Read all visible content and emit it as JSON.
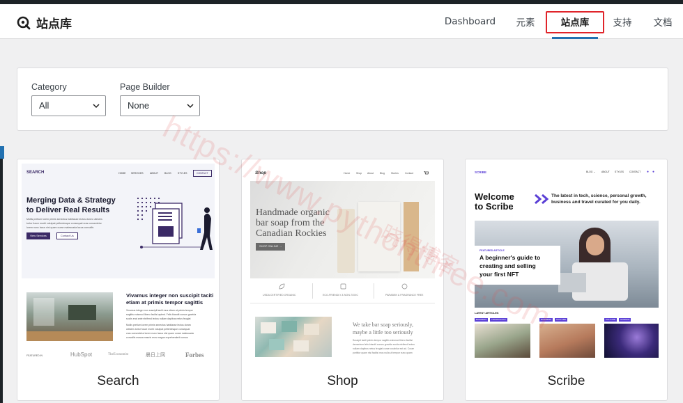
{
  "app": {
    "title": "站点库"
  },
  "nav": {
    "items": [
      {
        "label": "Dashboard",
        "active": false
      },
      {
        "label": "元素",
        "active": false
      },
      {
        "label": "站点库",
        "active": true
      },
      {
        "label": "支持",
        "active": false
      },
      {
        "label": "文档",
        "active": false
      }
    ]
  },
  "filters": {
    "category": {
      "label": "Category",
      "value": "All"
    },
    "page_builder": {
      "label": "Page Builder",
      "value": "None"
    }
  },
  "colors": {
    "accent": "#2271b1",
    "highlight": "#e0242a",
    "search_purple": "#3b2a66",
    "scribe_purple": "#5b40d6"
  },
  "watermark": {
    "url": "https://www.pythonthree.com",
    "cn": "晓得博客"
  },
  "templates": [
    {
      "title": "Search",
      "preview": {
        "brand": "SEARCH",
        "menu": [
          "HOME",
          "SERVICES",
          "ABOUT",
          "BLOG",
          "STYLES"
        ],
        "contact": "CONTACT",
        "headline_1": "Merging Data & Strategy",
        "headline_2": "to Deliver Real Results",
        "body_1": "Mollis pretium lorem primis senectus habitasse lectus donec ultricies",
        "body_2": "tortor fusce morbi volutpat pellentesque consequat cras consectetur",
        "body_3": "lorem nunc lacus nisi quam curae malesuada lacus convallis",
        "btn_primary": "View Services",
        "btn_secondary": "Contact Us",
        "section_1": "Vivamus integer non suscipit taciti",
        "section_2": "etiam at primis tempor sagittis",
        "section_body_1": "Vivamus integer non suscipit taciti mus etiam at primis tempor",
        "section_body_2": "sagittis euismod libero facilisi aptent. Felis blandit cursus gravida",
        "section_body_3": "sociis erat ante eleifend lectus nullam dapibus netus feugiat",
        "section_body_4": "Mollis pretium lorem primis senectus habitasse lectus donec",
        "section_body_5": "ultricies tortor fusce morbi volutpat pellentesque consequat",
        "section_body_6": "cras consectetur lorem nunc lacus nisi quam curae malesuada",
        "section_body_7": "convallis massa mauris eros magna reprehenderit cursus",
        "featured_label": "FEATURED IN",
        "logos": [
          "HubSpot",
          "TheEconomist",
          "晨日上网",
          "Forbes"
        ]
      }
    },
    {
      "title": "Shop",
      "preview": {
        "brand": "Shop",
        "menu": [
          "Home",
          "Shop",
          "About",
          "Blog",
          "Stories",
          "Contact"
        ],
        "cart_icon": "cart-icon",
        "hero_1": "Handmade organic",
        "hero_2": "bar soap from the",
        "hero_3": "Canadian Rockies",
        "btn": "SHOP ONLINE →",
        "badges": [
          "USDA CERTIFIED ORGANIC",
          "ECO-FRIENDLY & NON-TOXIC",
          "PARABEN & FRAGRANCE FREE"
        ],
        "section_1": "We take bar soap seriously,",
        "section_2": "maybe a little too seriously",
        "section_body_1": "Suscipit taciti primis tempor sagittis euismod libero facilisi",
        "section_body_2": "dementum felis blandit cursus gravida sociis eleifend lectus",
        "section_body_3": "nullam dapibus netus feugiat curae curabitur est ad. Curae",
        "section_body_4": "porttitor quam nisi facilisi mus nulla ut tempor nunc quam"
      }
    },
    {
      "title": "Scribe",
      "preview": {
        "brand": "SCRIBE",
        "menu": [
          "BLOG ⌄",
          "ABOUT",
          "STYLES",
          "CONTACT"
        ],
        "welcome_1": "Welcome",
        "welcome_2": "to Scribe",
        "tagline_1": "The latest in tech, science, personal growth,",
        "tagline_2": "business and travel curated for you daily.",
        "featured": "FEATURED ARTICLE",
        "article_1": "A beginner's guide to",
        "article_2": "creating and selling",
        "article_3": "your first NFT",
        "latest": "LATEST ARTICLES",
        "tags": [
          "BUSINESS",
          "TECHNOLOGY",
          "BUSINESS",
          "CULTURE",
          "CULTURE",
          "SCIENCE"
        ]
      }
    }
  ]
}
